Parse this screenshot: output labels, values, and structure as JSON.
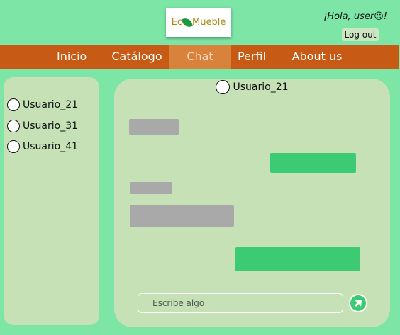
{
  "header": {
    "logo_text_left": "Ec",
    "logo_text_right": "Mueble",
    "greeting": "¡Hola, user☺!",
    "logout_label": "Log out"
  },
  "nav": {
    "items": [
      {
        "label": "Inicio"
      },
      {
        "label": "Catálogo"
      },
      {
        "label": "Chat",
        "active": true
      },
      {
        "label": "Perfil"
      },
      {
        "label": "About us"
      }
    ]
  },
  "sidebar": {
    "contacts": [
      {
        "name": "Usuario_21"
      },
      {
        "name": "Usuario_31"
      },
      {
        "name": "Usuario_41"
      }
    ]
  },
  "chat": {
    "contact_name": "Usuario_21",
    "composer_placeholder": "Escribe algo",
    "messages": [
      {
        "direction": "in"
      },
      {
        "direction": "out"
      },
      {
        "direction": "in"
      },
      {
        "direction": "in"
      },
      {
        "direction": "out"
      }
    ]
  },
  "colors": {
    "page_background": "#7de5a6",
    "nav_background": "#c75a14",
    "nav_active": "#d9823b",
    "panel_background": "#c6e1b5",
    "bubble_incoming": "#a9a9a9",
    "bubble_outgoing": "#3ccb72"
  },
  "icons": {
    "send": "send-arrow-icon",
    "leaf": "leaf-icon",
    "avatar": "user-circle-icon"
  }
}
